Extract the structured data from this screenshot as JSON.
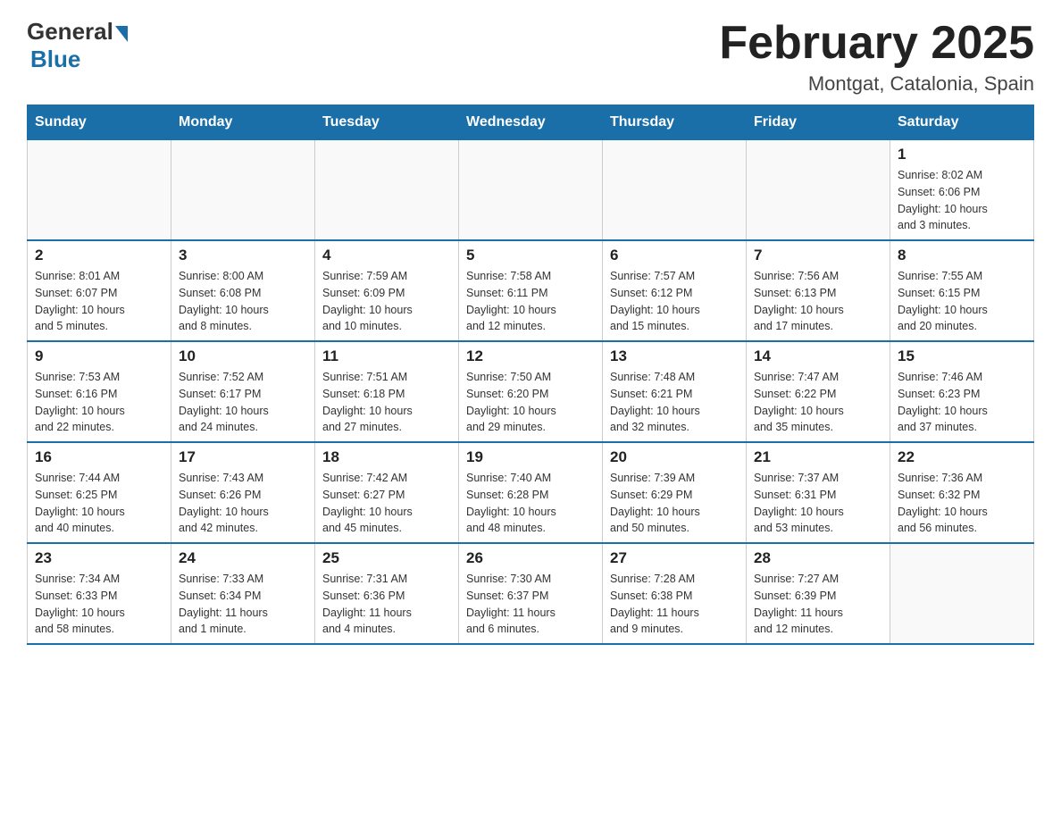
{
  "logo": {
    "text_general": "General",
    "text_blue": "Blue"
  },
  "title": "February 2025",
  "subtitle": "Montgat, Catalonia, Spain",
  "days_of_week": [
    "Sunday",
    "Monday",
    "Tuesday",
    "Wednesday",
    "Thursday",
    "Friday",
    "Saturday"
  ],
  "weeks": [
    [
      {
        "day": "",
        "info": ""
      },
      {
        "day": "",
        "info": ""
      },
      {
        "day": "",
        "info": ""
      },
      {
        "day": "",
        "info": ""
      },
      {
        "day": "",
        "info": ""
      },
      {
        "day": "",
        "info": ""
      },
      {
        "day": "1",
        "info": "Sunrise: 8:02 AM\nSunset: 6:06 PM\nDaylight: 10 hours\nand 3 minutes."
      }
    ],
    [
      {
        "day": "2",
        "info": "Sunrise: 8:01 AM\nSunset: 6:07 PM\nDaylight: 10 hours\nand 5 minutes."
      },
      {
        "day": "3",
        "info": "Sunrise: 8:00 AM\nSunset: 6:08 PM\nDaylight: 10 hours\nand 8 minutes."
      },
      {
        "day": "4",
        "info": "Sunrise: 7:59 AM\nSunset: 6:09 PM\nDaylight: 10 hours\nand 10 minutes."
      },
      {
        "day": "5",
        "info": "Sunrise: 7:58 AM\nSunset: 6:11 PM\nDaylight: 10 hours\nand 12 minutes."
      },
      {
        "day": "6",
        "info": "Sunrise: 7:57 AM\nSunset: 6:12 PM\nDaylight: 10 hours\nand 15 minutes."
      },
      {
        "day": "7",
        "info": "Sunrise: 7:56 AM\nSunset: 6:13 PM\nDaylight: 10 hours\nand 17 minutes."
      },
      {
        "day": "8",
        "info": "Sunrise: 7:55 AM\nSunset: 6:15 PM\nDaylight: 10 hours\nand 20 minutes."
      }
    ],
    [
      {
        "day": "9",
        "info": "Sunrise: 7:53 AM\nSunset: 6:16 PM\nDaylight: 10 hours\nand 22 minutes."
      },
      {
        "day": "10",
        "info": "Sunrise: 7:52 AM\nSunset: 6:17 PM\nDaylight: 10 hours\nand 24 minutes."
      },
      {
        "day": "11",
        "info": "Sunrise: 7:51 AM\nSunset: 6:18 PM\nDaylight: 10 hours\nand 27 minutes."
      },
      {
        "day": "12",
        "info": "Sunrise: 7:50 AM\nSunset: 6:20 PM\nDaylight: 10 hours\nand 29 minutes."
      },
      {
        "day": "13",
        "info": "Sunrise: 7:48 AM\nSunset: 6:21 PM\nDaylight: 10 hours\nand 32 minutes."
      },
      {
        "day": "14",
        "info": "Sunrise: 7:47 AM\nSunset: 6:22 PM\nDaylight: 10 hours\nand 35 minutes."
      },
      {
        "day": "15",
        "info": "Sunrise: 7:46 AM\nSunset: 6:23 PM\nDaylight: 10 hours\nand 37 minutes."
      }
    ],
    [
      {
        "day": "16",
        "info": "Sunrise: 7:44 AM\nSunset: 6:25 PM\nDaylight: 10 hours\nand 40 minutes."
      },
      {
        "day": "17",
        "info": "Sunrise: 7:43 AM\nSunset: 6:26 PM\nDaylight: 10 hours\nand 42 minutes."
      },
      {
        "day": "18",
        "info": "Sunrise: 7:42 AM\nSunset: 6:27 PM\nDaylight: 10 hours\nand 45 minutes."
      },
      {
        "day": "19",
        "info": "Sunrise: 7:40 AM\nSunset: 6:28 PM\nDaylight: 10 hours\nand 48 minutes."
      },
      {
        "day": "20",
        "info": "Sunrise: 7:39 AM\nSunset: 6:29 PM\nDaylight: 10 hours\nand 50 minutes."
      },
      {
        "day": "21",
        "info": "Sunrise: 7:37 AM\nSunset: 6:31 PM\nDaylight: 10 hours\nand 53 minutes."
      },
      {
        "day": "22",
        "info": "Sunrise: 7:36 AM\nSunset: 6:32 PM\nDaylight: 10 hours\nand 56 minutes."
      }
    ],
    [
      {
        "day": "23",
        "info": "Sunrise: 7:34 AM\nSunset: 6:33 PM\nDaylight: 10 hours\nand 58 minutes."
      },
      {
        "day": "24",
        "info": "Sunrise: 7:33 AM\nSunset: 6:34 PM\nDaylight: 11 hours\nand 1 minute."
      },
      {
        "day": "25",
        "info": "Sunrise: 7:31 AM\nSunset: 6:36 PM\nDaylight: 11 hours\nand 4 minutes."
      },
      {
        "day": "26",
        "info": "Sunrise: 7:30 AM\nSunset: 6:37 PM\nDaylight: 11 hours\nand 6 minutes."
      },
      {
        "day": "27",
        "info": "Sunrise: 7:28 AM\nSunset: 6:38 PM\nDaylight: 11 hours\nand 9 minutes."
      },
      {
        "day": "28",
        "info": "Sunrise: 7:27 AM\nSunset: 6:39 PM\nDaylight: 11 hours\nand 12 minutes."
      },
      {
        "day": "",
        "info": ""
      }
    ]
  ]
}
